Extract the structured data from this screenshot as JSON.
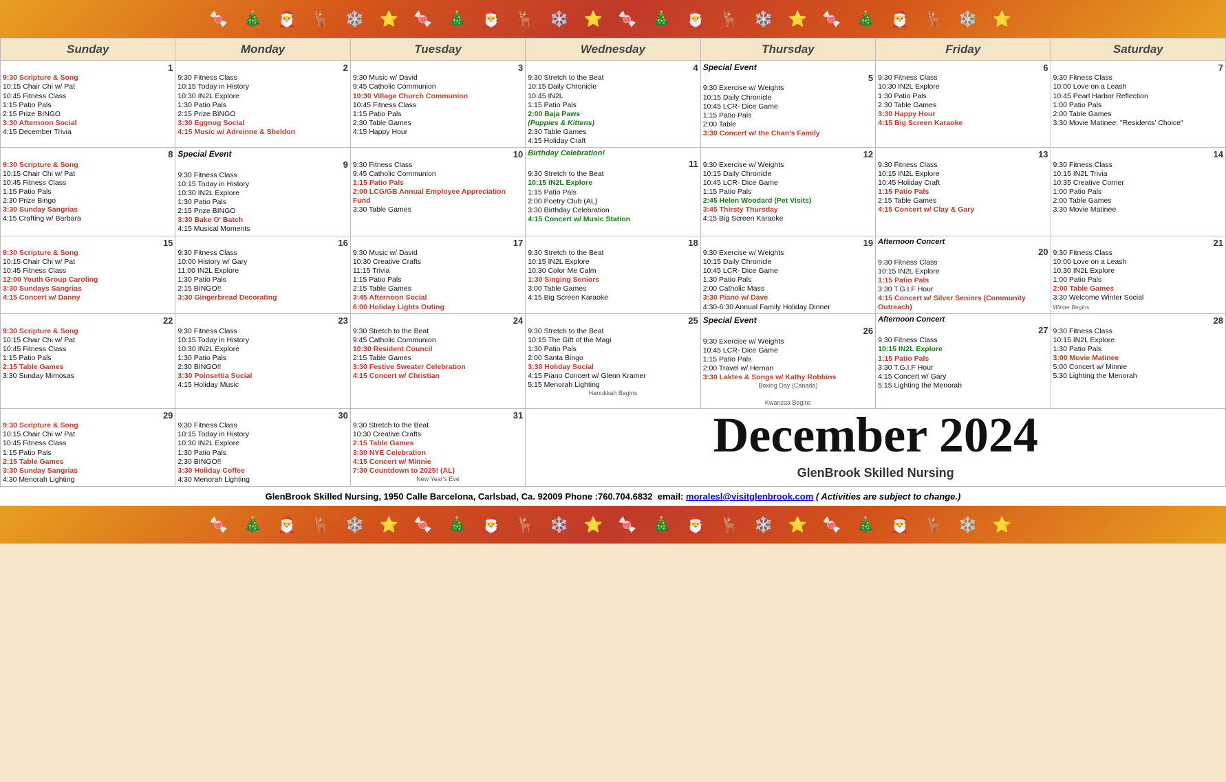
{
  "calendar": {
    "month": "December",
    "year": "2024",
    "facility": "GlenBrook Skilled Nursing",
    "facility_address": "GlenBrook Skilled Nursing, 1950 Calle Barcelona, Carlsbad, Ca. 92009 Phone :760.704.6832  email: moralesl@visitglenbrook.com ( Activities are subject to change.)",
    "days_of_week": [
      "Sunday",
      "Monday",
      "Tuesday",
      "Wednesday",
      "Thursday",
      "Friday",
      "Saturday"
    ],
    "colors": {
      "red": "#c0392b",
      "green": "#1a7a1a",
      "black": "#111111",
      "orange": "#e67e00",
      "blue": "#1a4fa0",
      "background": "#f5e6c8"
    }
  }
}
